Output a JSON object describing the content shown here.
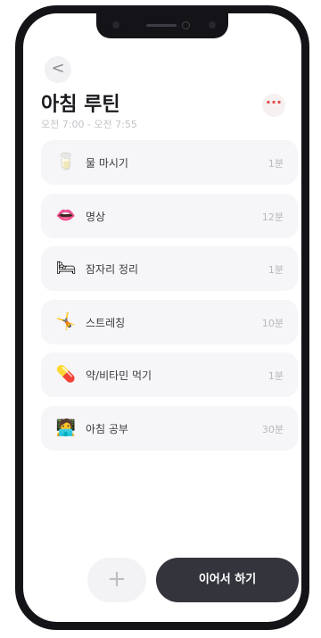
{
  "header": {
    "back_icon": "<",
    "title": "아침 루틴",
    "time_range": "오전 7:00 - 오전 7:55",
    "more_icon": "···"
  },
  "routine": {
    "items": [
      {
        "icon": "🥛",
        "icon_name": "water-glass-icon",
        "label": "물 마시기",
        "duration": "1분"
      },
      {
        "icon": "👄",
        "icon_name": "lips-icon",
        "label": "명상",
        "duration": "12분"
      },
      {
        "icon": "🛏",
        "icon_name": "bed-icon",
        "label": "잠자리 정리",
        "duration": "1분"
      },
      {
        "icon": "🤸",
        "icon_name": "stretching-icon",
        "label": "스트레칭",
        "duration": "10분"
      },
      {
        "icon": "💊",
        "icon_name": "pill-icon",
        "label": "약/비타민 먹기",
        "duration": "1분"
      },
      {
        "icon": "🧑‍💻",
        "icon_name": "study-person-icon",
        "label": "아침 공부",
        "duration": "30분"
      }
    ]
  },
  "footer": {
    "add_icon": "+",
    "continue_label": "이어서 하기"
  },
  "colors": {
    "accent": "#e24a4a",
    "dark_button": "#34353c",
    "card_bg": "#f6f6f8"
  }
}
